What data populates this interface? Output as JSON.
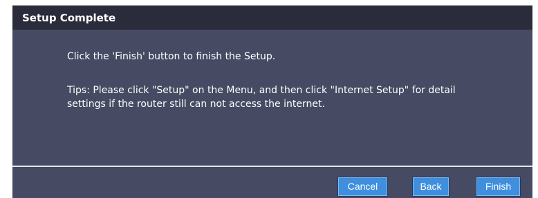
{
  "dialog": {
    "title": "Setup Complete",
    "message": "Click the 'Finish' button to finish the Setup.",
    "tips": "Tips: Please click \"Setup\" on the Menu, and then click \"Internet Setup\" for detail settings if the router still can not access the internet."
  },
  "buttons": {
    "cancel": "Cancel",
    "back": "Back",
    "finish": "Finish"
  },
  "colors": {
    "panel_background": "#464b63",
    "header_background": "#2a2c3b",
    "button_background": "#3f8fde",
    "text": "#ffffff"
  }
}
